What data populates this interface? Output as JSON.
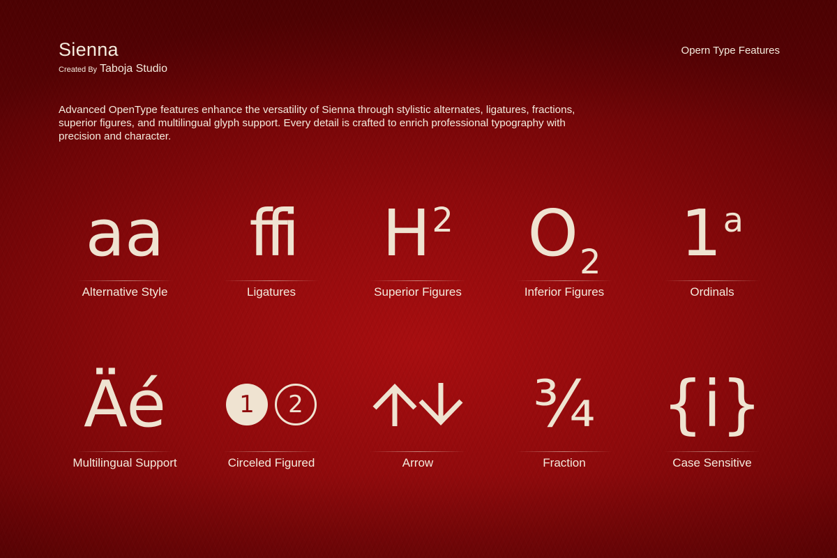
{
  "header": {
    "title": "Sienna",
    "created_by_prefix": "Created By",
    "created_by_name": "Taboja Studio",
    "top_right": "Opern Type Features"
  },
  "intro": "Advanced OpenType features enhance the versatility of Sienna through stylistic alternates, ligatures, fractions, superior figures, and multilingual glyph support. Every detail is crafted to enrich professional typography with precision and character.",
  "features": [
    {
      "glyph": "aa",
      "label": "Alternative Style"
    },
    {
      "glyph": "ffi",
      "label": "Ligatures"
    },
    {
      "glyph_base": "H",
      "glyph_mark": "2",
      "label": "Superior Figures"
    },
    {
      "glyph_base": "O",
      "glyph_mark": "2",
      "label": "Inferior Figures"
    },
    {
      "glyph_base": "1",
      "glyph_mark": "a",
      "label": "Ordinals"
    },
    {
      "glyph": "Äé",
      "label": "Multilingual Support"
    },
    {
      "glyph_a": "1",
      "glyph_b": "2",
      "label": "Circeled Figured"
    },
    {
      "icon_a": "up-arrow-icon",
      "icon_b": "down-arrow-icon",
      "label": "Arrow"
    },
    {
      "glyph": "¾",
      "label": "Fraction"
    },
    {
      "glyph": "{i}",
      "label": "Case Sensitive"
    }
  ],
  "colors": {
    "background": "#8e0a0c",
    "glyph": "#efe3d1",
    "text": "#f4ebdd"
  }
}
